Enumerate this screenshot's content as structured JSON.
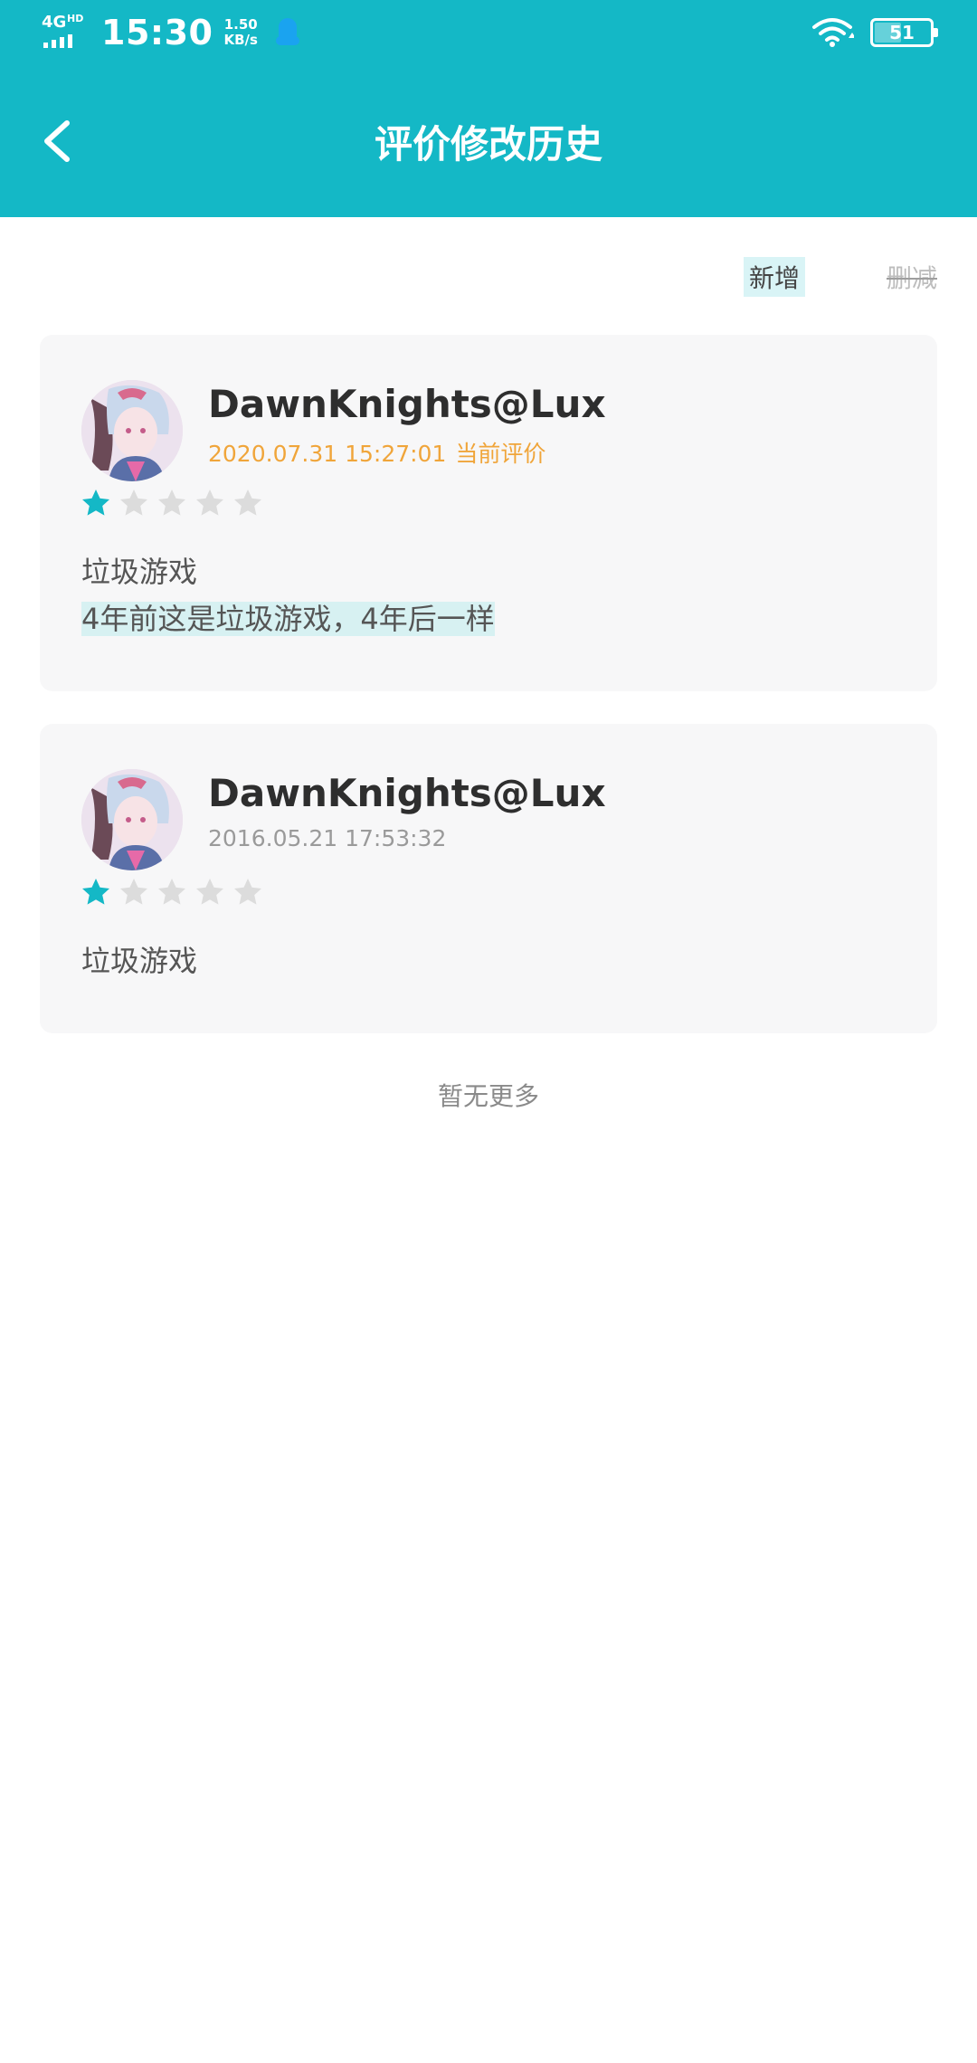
{
  "status_bar": {
    "network": "4G",
    "network_badge": "HD",
    "time": "15:30",
    "speed_value": "1.50",
    "speed_unit": "KB/s",
    "battery_level": "51"
  },
  "header": {
    "title": "评价修改历史"
  },
  "legend": {
    "added_label": "新增",
    "removed_label": "删减"
  },
  "reviews": [
    {
      "username": "DawnKnights@Lux",
      "date": "2020.07.31 15:27:01",
      "tag": "当前评价",
      "rating": 1,
      "max_rating": 5,
      "line1": "垃圾游戏",
      "line2_added": "4年前这是垃圾游戏，4年后一样"
    },
    {
      "username": "DawnKnights@Lux",
      "date": "2016.05.21 17:53:32",
      "rating": 1,
      "max_rating": 5,
      "line1": "垃圾游戏"
    }
  ],
  "footer": {
    "no_more": "暂无更多"
  },
  "colors": {
    "accent": "#14b8c6",
    "current_date": "#f0a53a",
    "added_highlight": "#d7f1f2",
    "star_on": "#14b8c6",
    "star_off": "#dcdcdc"
  },
  "icons": [
    "back-arrow-icon",
    "wifi-icon",
    "battery-icon",
    "qq-notification-icon",
    "star-icon"
  ]
}
